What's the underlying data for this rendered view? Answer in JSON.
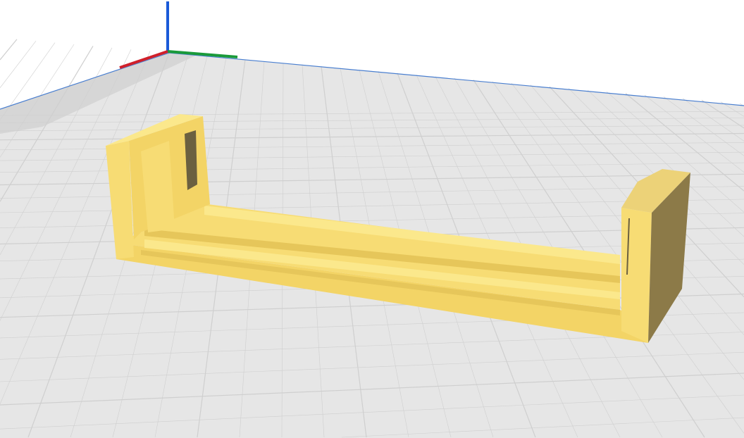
{
  "viewport": {
    "background_color": "#ffffff",
    "plate_color": "#e6e6e6",
    "grid_color": "#cfcfcf",
    "plate_edge_color": "#4a7fd0"
  },
  "axes": {
    "x_color": "#d0202a",
    "y_color": "#1a9a3a",
    "z_color": "#1a5ad8"
  },
  "model": {
    "color_top": "#fbe88c",
    "color_front": "#f7dc74",
    "color_shadow": "#e6c65a",
    "color_side": "#8c7a48"
  }
}
